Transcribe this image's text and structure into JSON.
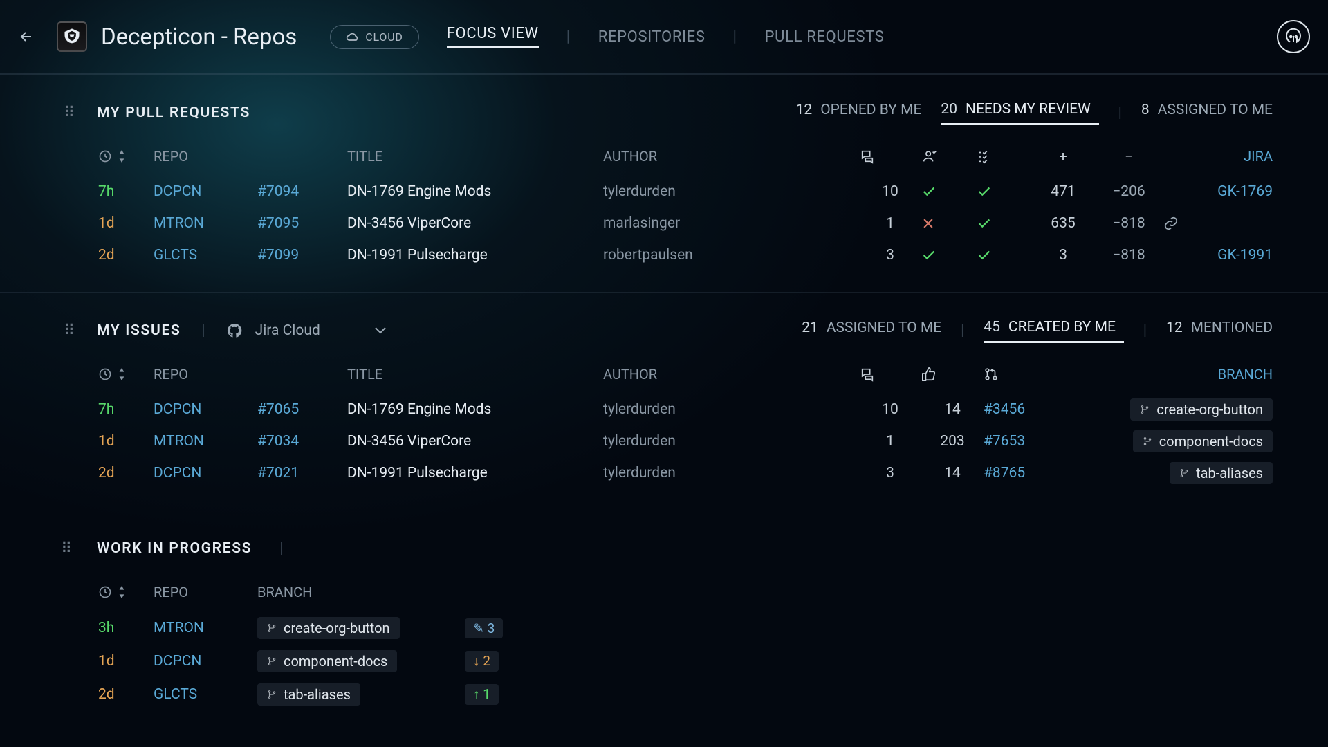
{
  "header": {
    "title": "Decepticon - Repos",
    "cloud_label": "CLOUD",
    "tabs": [
      "FOCUS VIEW",
      "REPOSITORIES",
      "PULL REQUESTS"
    ]
  },
  "prs": {
    "title": "MY PULL REQUESTS",
    "filters": [
      {
        "count": "12",
        "label": "OPENED BY ME"
      },
      {
        "count": "20",
        "label": "NEEDS MY REVIEW"
      },
      {
        "count": "8",
        "label": "ASSIGNED TO ME"
      }
    ],
    "cols": {
      "repo": "REPO",
      "title": "TITLE",
      "author": "AUTHOR",
      "jira": "JIRA"
    },
    "rows": [
      {
        "age": "7h",
        "ageCls": "time-green",
        "repo": "DCPCN",
        "num": "#7094",
        "title": "DN-1769 Engine Mods",
        "author": "tylerdurden",
        "comments": "10",
        "r1": "check",
        "r2": "check",
        "add": "471",
        "del": "−206",
        "jira": "GK-1769",
        "jiraType": "link"
      },
      {
        "age": "1d",
        "ageCls": "time-amber",
        "repo": "MTRON",
        "num": "#7095",
        "title": "DN-3456 ViperCore",
        "author": "marlasinger",
        "comments": "1",
        "r1": "x",
        "r2": "check",
        "add": "635",
        "del": "−818",
        "jira": "",
        "jiraType": "icon"
      },
      {
        "age": "2d",
        "ageCls": "time-amber",
        "repo": "GLCTS",
        "num": "#7099",
        "title": "DN-1991 Pulsecharge",
        "author": "robertpaulsen",
        "comments": "3",
        "r1": "check",
        "r2": "check",
        "add": "3",
        "del": "−818",
        "jira": "GK-1991",
        "jiraType": "link"
      }
    ]
  },
  "issues": {
    "title": "MY ISSUES",
    "source": "Jira Cloud",
    "filters": [
      {
        "count": "21",
        "label": "ASSIGNED TO ME"
      },
      {
        "count": "45",
        "label": "CREATED BY ME"
      },
      {
        "count": "12",
        "label": "MENTIONED"
      }
    ],
    "cols": {
      "repo": "REPO",
      "title": "TITLE",
      "author": "AUTHOR",
      "branch": "BRANCH"
    },
    "rows": [
      {
        "age": "7h",
        "ageCls": "time-green",
        "repo": "DCPCN",
        "num": "#7065",
        "title": "DN-1769 Engine Mods",
        "author": "tylerdurden",
        "comments": "10",
        "likes": "14",
        "pr": "#3456",
        "branch": "create-org-button"
      },
      {
        "age": "1d",
        "ageCls": "time-amber",
        "repo": "MTRON",
        "num": "#7034",
        "title": "DN-3456 ViperCore",
        "author": "tylerdurden",
        "comments": "1",
        "likes": "203",
        "pr": "#7653",
        "branch": "component-docs"
      },
      {
        "age": "2d",
        "ageCls": "time-amber",
        "repo": "DCPCN",
        "num": "#7021",
        "title": "DN-1991 Pulsecharge",
        "author": "tylerdurden",
        "comments": "3",
        "likes": "14",
        "pr": "#8765",
        "branch": "tab-aliases"
      }
    ]
  },
  "wip": {
    "title": "WORK IN PROGRESS",
    "cols": {
      "repo": "REPO",
      "branch": "BRANCH"
    },
    "rows": [
      {
        "age": "3h",
        "ageCls": "time-green",
        "repo": "MTRON",
        "branch": "create-org-button",
        "statIcon": "✎",
        "stat": "3",
        "statCls": "stat-blue"
      },
      {
        "age": "1d",
        "ageCls": "time-amber",
        "repo": "DCPCN",
        "branch": "component-docs",
        "statIcon": "↓",
        "stat": "2",
        "statCls": "stat-amber"
      },
      {
        "age": "2d",
        "ageCls": "time-amber",
        "repo": "GLCTS",
        "branch": "tab-aliases",
        "statIcon": "↑",
        "stat": "1",
        "statCls": "stat-green"
      }
    ]
  }
}
